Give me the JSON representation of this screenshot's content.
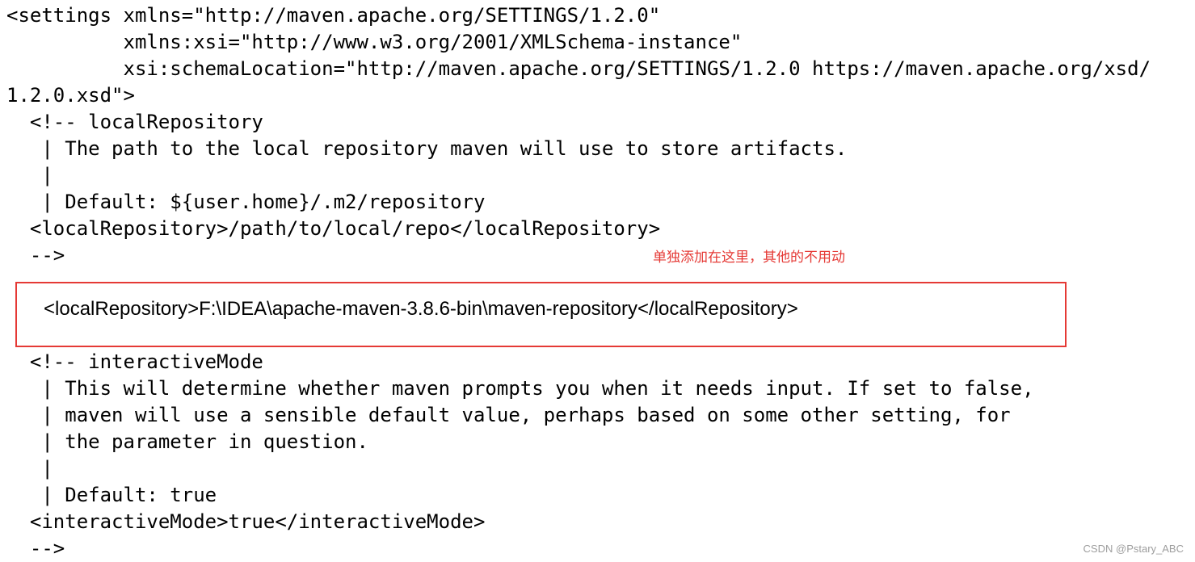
{
  "code_top": [
    "<settings xmlns=\"http://maven.apache.org/SETTINGS/1.2.0\"",
    "          xmlns:xsi=\"http://www.w3.org/2001/XMLSchema-instance\"",
    "          xsi:schemaLocation=\"http://maven.apache.org/SETTINGS/1.2.0 https://maven.apache.org/xsd/",
    "1.2.0.xsd\">",
    "  <!-- localRepository",
    "   | The path to the local repository maven will use to store artifacts.",
    "   |",
    "   | Default: ${user.home}/.m2/repository",
    "  <localRepository>/path/to/local/repo</localRepository>",
    "  -->"
  ],
  "annotation": "单独添加在这里，其他的不用动",
  "highlighted_line": "<localRepository>F:\\IDEA\\apache-maven-3.8.6-bin\\maven-repository</localRepository>",
  "code_bottom": [
    "  <!-- interactiveMode",
    "   | This will determine whether maven prompts you when it needs input. If set to false,",
    "   | maven will use a sensible default value, perhaps based on some other setting, for",
    "   | the parameter in question.",
    "   |",
    "   | Default: true",
    "  <interactiveMode>true</interactiveMode>",
    "  -->"
  ],
  "watermark": "CSDN @Pstary_ABC",
  "colors": {
    "annotation": "#e53935",
    "box_border": "#e53935",
    "text": "#000000",
    "background": "#ffffff"
  }
}
